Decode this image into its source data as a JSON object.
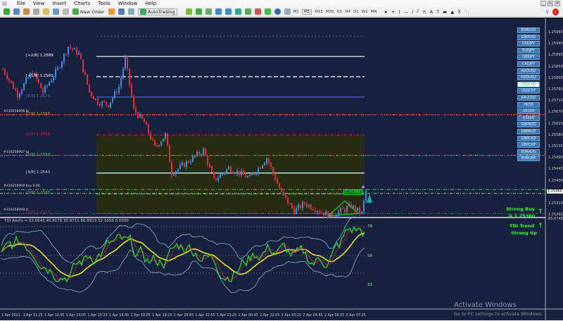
{
  "menu": [
    "File",
    "View",
    "Insert",
    "Charts",
    "Tools",
    "Window",
    "Help"
  ],
  "toolbar": {
    "new_order": "New Order",
    "autotrading": "AutoTrading",
    "timeframes": [
      "M1",
      "M5",
      "M15",
      "M30",
      "H1",
      "H4",
      "D1",
      "W1",
      "MN"
    ]
  },
  "symbols": [
    "EURUSD",
    "GBPUSD",
    "USDJPY",
    "EURJPY",
    "GBPJPY",
    "CADJPY",
    "AUDUSD",
    "NZDUSD",
    "USDCAD",
    "USDCHF",
    "XAUUSD",
    "HK50",
    "UK100",
    "US500",
    "GBPNZD",
    "GBPAUD",
    "GBPCAD",
    "GBPCHF",
    "EURAUD",
    "EURGBP"
  ],
  "selected_symbol": "USDCAD",
  "price_axis": [
    "1.25985",
    "1.25940",
    "1.25895",
    "1.25850",
    "1.25805",
    "1.25760",
    "1.25715",
    "1.25670",
    "1.25625",
    "1.25580",
    "1.25535",
    "1.25490",
    "1.25445",
    "1.25400",
    "1.25360",
    "1.25310",
    "1.25265"
  ],
  "current_price": "1.25360",
  "indicator_max": "83.6748",
  "murrey_levels": [
    {
      "label": "[+2/8]",
      "price": "1.2589",
      "value": 1.2589,
      "color": "#ffffff"
    },
    {
      "label": "[+1/8]",
      "price": "1.2581",
      "value": 1.2581,
      "color": "#ffffff"
    },
    {
      "label": "[8/8]",
      "price": "1.2573",
      "value": 1.2573,
      "color": "#3a6df0"
    },
    {
      "label": "[7/8]",
      "price": "1.2566",
      "value": 1.2566,
      "color": "#e08a2c"
    },
    {
      "label": "[6/8]",
      "price": "1.2558",
      "value": 1.2558,
      "color": "#d0203a"
    },
    {
      "label": "[5/8]",
      "price": "1.2550",
      "value": 1.255,
      "color": "#3fd12b"
    },
    {
      "label": "[4/8]",
      "price": "1.2543",
      "value": 1.2543,
      "color": "#a8e0f0"
    },
    {
      "label": "[3/8]",
      "price": "1.2535",
      "value": 1.2535,
      "color": "#3fd12b"
    },
    {
      "label": "[2/8]",
      "price": "1.2527",
      "value": 1.2527,
      "color": "#d0203a"
    }
  ],
  "orders": [
    {
      "label": "#316258906 tp",
      "value": 1.2566,
      "color": "#d0203a"
    },
    {
      "label": "#316258907 tp",
      "value": 1.255,
      "color": "#d0203a"
    },
    {
      "label": "#316258908 buy 0.06",
      "value": 1.25365,
      "color": "#3fd12b"
    },
    {
      "label": "#316258908 sl",
      "value": 1.2527,
      "color": "#d0203a"
    }
  ],
  "pattern_label": "1.25365",
  "indicator": {
    "title": "TDI Alerts = 62.6646 46.8179 30.9711 66.8919 52.1656 0.0000",
    "levels": [
      "78",
      "50",
      "33"
    ]
  },
  "alerts": {
    "line1": "Strong Buy",
    "line2": "@ 1.25360",
    "line3": "TDI Trend",
    "line4": "Strong Up"
  },
  "time_axis": [
    "1 Apr 2021",
    "1 Apr 11:25",
    "1 Apr 12:45",
    "1 Apr 14:05",
    "1 Apr 15:25",
    "1 Apr 16:45",
    "1 Apr 18:05",
    "1 Apr 19:25",
    "1 Apr 20:45",
    "1 Apr 22:05",
    "1 Apr 23:25",
    "2 Apr 00:45",
    "2 Apr 02:05",
    "2 Apr 03:25",
    "2 Apr 04:45",
    "2 Apr 06:05",
    "2 Apr 07:25"
  ],
  "watermark": {
    "title": "Activate Windows",
    "subtitle": "Go to PC settings to activate Windows."
  },
  "price_path": [
    [
      0,
      1.2584
    ],
    [
      7,
      1.2574
    ],
    [
      14,
      1.2583
    ],
    [
      19,
      1.2575
    ],
    [
      26,
      1.2584
    ],
    [
      31,
      1.2593
    ],
    [
      36,
      1.259
    ],
    [
      41,
      1.2575
    ],
    [
      45,
      1.2571
    ],
    [
      50,
      1.257
    ],
    [
      55,
      1.2577
    ],
    [
      58,
      1.2588
    ],
    [
      62,
      1.2568
    ],
    [
      67,
      1.2563
    ],
    [
      72,
      1.2553
    ],
    [
      77,
      1.2558
    ],
    [
      80,
      1.2543
    ],
    [
      87,
      1.2547
    ],
    [
      95,
      1.2552
    ],
    [
      100,
      1.254
    ],
    [
      107,
      1.2545
    ],
    [
      117,
      1.2541
    ],
    [
      125,
      1.2549
    ],
    [
      132,
      1.2535
    ],
    [
      138,
      1.2528
    ],
    [
      143,
      1.2531
    ],
    [
      155,
      1.2526
    ],
    [
      165,
      1.253
    ],
    [
      170,
      1.2527
    ],
    [
      172,
      1.2536
    ]
  ],
  "colors": {
    "bg": "#17213e",
    "bull": "#3a8ee8",
    "bear": "#e8283a",
    "zone": "#262b12"
  }
}
